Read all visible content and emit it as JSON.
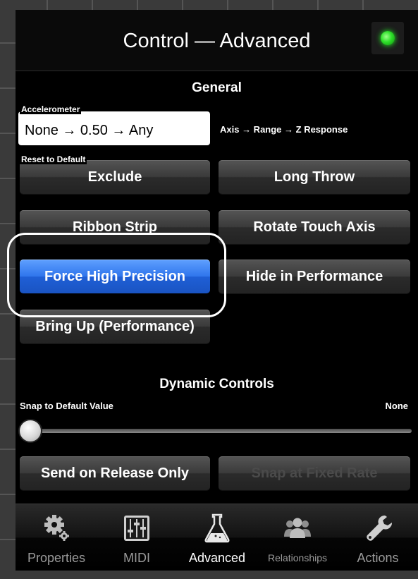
{
  "window": {
    "title": "Control — Advanced",
    "status_led_color": "#2ee02a"
  },
  "general": {
    "heading": "General",
    "accelerometer": {
      "label": "Accelerometer",
      "value": "None → 0.50 → Any",
      "note": "Axis → Range → Z Response"
    },
    "reset_label": "Reset to Default",
    "buttons": {
      "exclude": "Exclude",
      "long_throw": "Long Throw",
      "ribbon_strip": "Ribbon Strip",
      "rotate_touch_axis": "Rotate Touch Axis",
      "force_high_precision": "Force High Precision",
      "hide_in_performance": "Hide in Performance",
      "bring_up": "Bring Up (Performance)"
    },
    "active_button": "force_high_precision"
  },
  "dynamic": {
    "heading": "Dynamic Controls",
    "snap_label": "Snap to Default Value",
    "snap_value": "None",
    "slider_level": 0,
    "send_on_release": "Send on Release Only",
    "snap_fixed_rate": "Snap at Fixed Rate"
  },
  "tabs": [
    {
      "label": "Properties",
      "icon": "gears-icon"
    },
    {
      "label": "MIDI",
      "icon": "mixer-sliders-icon"
    },
    {
      "label": "Advanced",
      "icon": "flask-icon",
      "active": true
    },
    {
      "label": "Relationships",
      "icon": "people-icon"
    },
    {
      "label": "Actions",
      "icon": "wrench-icon"
    }
  ],
  "colors": {
    "accent_blue": "#2f75ec",
    "led_green": "#2ee02a",
    "panel_bg": "#000000"
  }
}
